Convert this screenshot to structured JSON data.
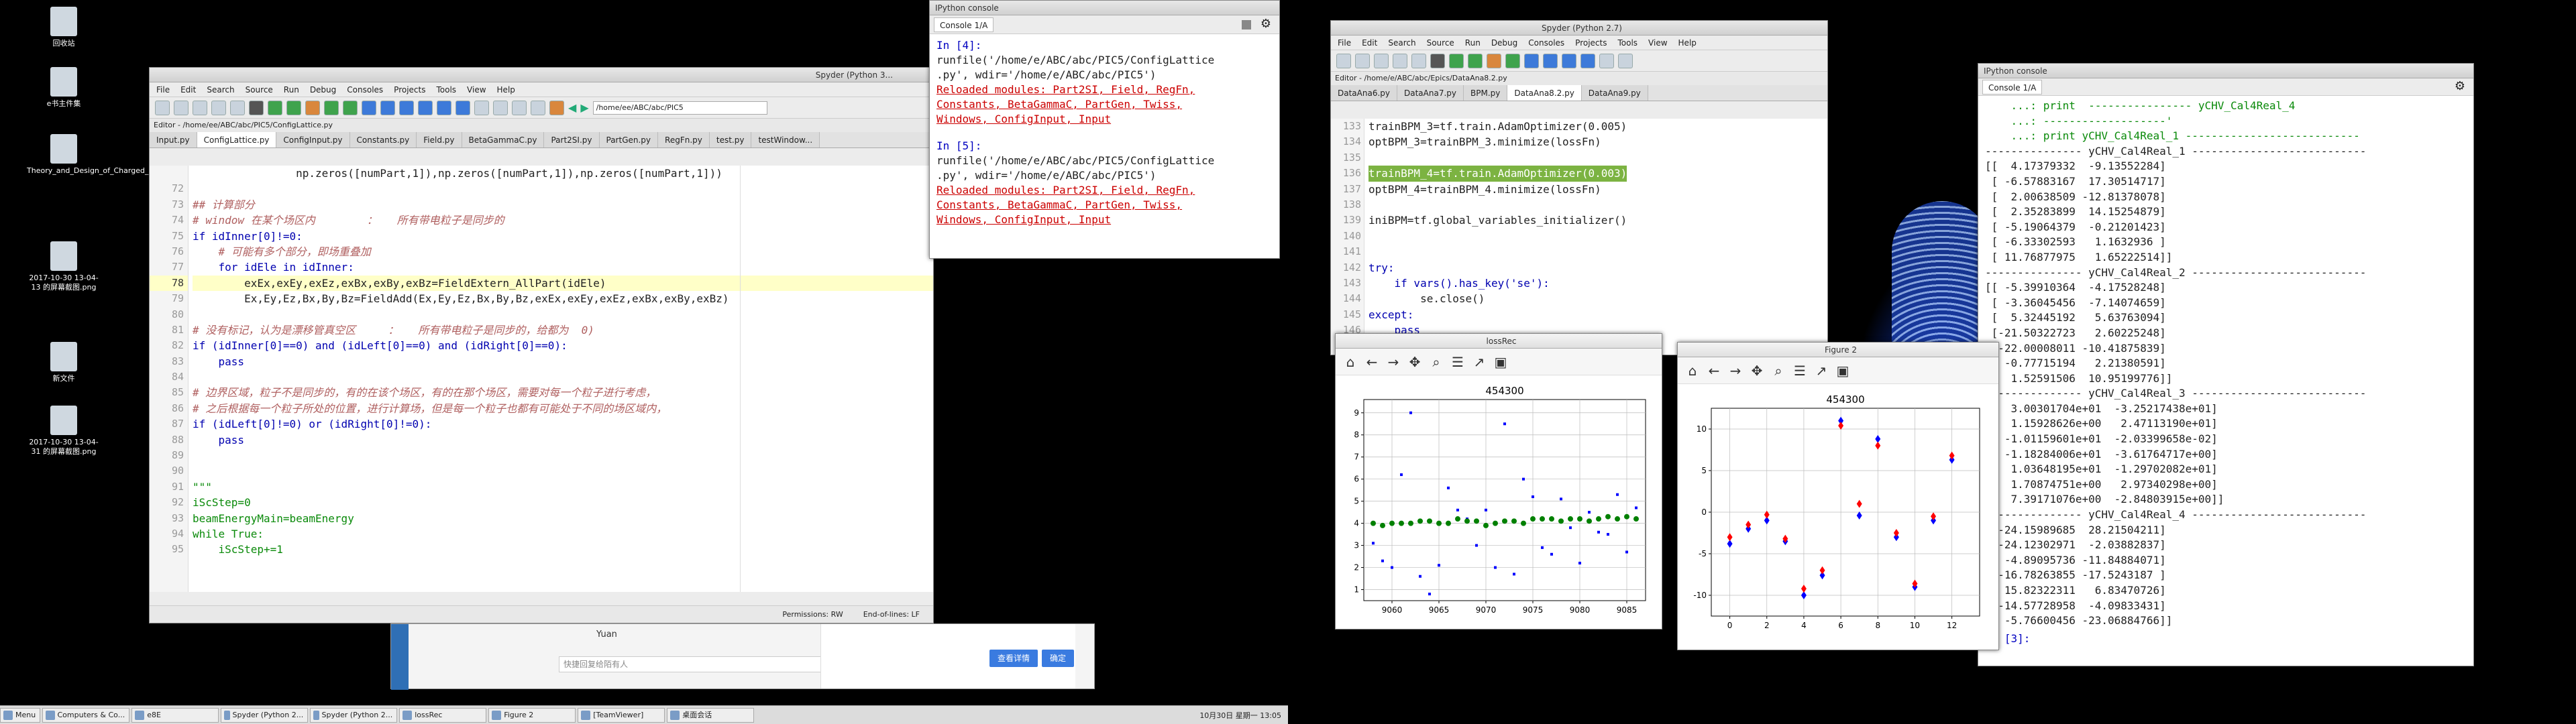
{
  "desktop": {
    "icons": [
      {
        "label": "回收站"
      },
      {
        "label": "e书主件集"
      },
      {
        "label": "Theory_and_Design_of_Charged_Particle_[Reiser_M.]_(BookFi..."
      },
      {
        "label": "2017-10-30 13-04-13 的屏幕截图.png"
      },
      {
        "label": "新文件"
      },
      {
        "label": "2017-10-30 13-04-31 的屏幕截图.png"
      }
    ]
  },
  "spyder_left": {
    "title": "Spyder (Python 3...",
    "menu": [
      "File",
      "Edit",
      "Search",
      "Source",
      "Run",
      "Debug",
      "Consoles",
      "Projects",
      "Tools",
      "View",
      "Help"
    ],
    "path": "/home/ee/ABC/abc/PIC5",
    "editor_title": "Editor - /home/ee/ABC/abc/PIC5/ConfigLattice.py",
    "tabs": [
      "Input.py",
      "ConfigLattice.py",
      "ConfigInput.py",
      "Constants.py",
      "Field.py",
      "BetaGammaC.py",
      "Part2SI.py",
      "PartGen.py",
      "RegFn.py",
      "test.py",
      "testWindow..."
    ],
    "active_tab": 1,
    "lines": [
      {
        "n": "",
        "t": "                np.zeros([numPart,1]),np.zeros([numPart,1]),np.zeros([numPart,1]))",
        "c": ""
      },
      {
        "n": "72",
        "t": "",
        "c": ""
      },
      {
        "n": "73",
        "t": "## 计算部分",
        "c": "cm"
      },
      {
        "n": "74",
        "t": "# window 在某个场区内        ：   所有带电粒子是同步的",
        "c": "cm"
      },
      {
        "n": "75",
        "t": "if idInner[0]!=0:",
        "c": "kw"
      },
      {
        "n": "76",
        "t": "    # 可能有多个部分，即场重叠加",
        "c": "cm"
      },
      {
        "n": "77",
        "t": "    for idEle in idInner:",
        "c": "kw"
      },
      {
        "n": "78",
        "t": "        exEx,exEy,exEz,exBx,exBy,exBz=FieldExtern_AllPart(idEle)",
        "c": ""
      },
      {
        "n": "79",
        "t": "        Ex,Ey,Ez,Bx,By,Bz=FieldAdd(Ex,Ey,Ez,Bx,By,Bz,exEx,exEy,exEz,exBx,exBy,exBz)",
        "c": ""
      },
      {
        "n": "80",
        "t": "",
        "c": ""
      },
      {
        "n": "81",
        "t": "# 没有标记，认为是漂移管真空区     ：   所有带电粒子是同步的，给都为  0)",
        "c": "cm"
      },
      {
        "n": "82",
        "t": "if (idInner[0]==0) and (idLeft[0]==0) and (idRight[0]==0):",
        "c": "kw"
      },
      {
        "n": "83",
        "t": "    pass",
        "c": "kw"
      },
      {
        "n": "84",
        "t": "",
        "c": ""
      },
      {
        "n": "85",
        "t": "# 边界区域，粒子不是同步的，有的在该个场区，有的在那个场区，需要对每一个粒子进行考虑，",
        "c": "cm"
      },
      {
        "n": "86",
        "t": "# 之后根据每一个粒子所处的位置，进行计算场，但是每一个粒子也都有可能处于不同的场区域内，",
        "c": "cm"
      },
      {
        "n": "87",
        "t": "if (idLeft[0]!=0) or (idRight[0]!=0):",
        "c": "kw"
      },
      {
        "n": "88",
        "t": "    pass",
        "c": "kw"
      },
      {
        "n": "89",
        "t": "",
        "c": ""
      },
      {
        "n": "90",
        "t": "",
        "c": ""
      },
      {
        "n": "91",
        "t": "\"\"\"",
        "c": "str"
      },
      {
        "n": "92",
        "t": "iScStep=0",
        "c": "str"
      },
      {
        "n": "93",
        "t": "beamEnergyMain=beamEnergy",
        "c": "str"
      },
      {
        "n": "94",
        "t": "while True:",
        "c": "str"
      },
      {
        "n": "95",
        "t": "    iScStep+=1",
        "c": "str"
      }
    ],
    "highlight_line": 7,
    "status": {
      "permissions": "Permissions: RW",
      "eol": "End-of-lines: LF"
    }
  },
  "ipython_left": {
    "title": "IPython console",
    "tab": "Console 1/A",
    "blocks": [
      {
        "prompt": "In [4]:",
        "cmd1": "runfile('/home/e/ABC/abc/PIC5/ConfigLattice",
        "cmd2": ".py', wdir='/home/e/ABC/abc/PIC5')",
        "reload": "Reloaded modules: Part2SI, Field, RegFn,",
        "mods1": "Constants, BetaGammaC, PartGen, Twiss,",
        "mods2": "Windows, ConfigInput, Input"
      },
      {
        "prompt": "In [5]:",
        "cmd1": "runfile('/home/e/ABC/abc/PIC5/ConfigLattice",
        "cmd2": ".py', wdir='/home/e/ABC/abc/PIC5')",
        "reload": "Reloaded modules: Part2SI, Field, RegFn,",
        "mods1": "Constants, BetaGammaC, PartGen, Twiss,",
        "mods2": "Windows, ConfigInput, Input"
      }
    ]
  },
  "chat_popup": {
    "name": "Yuan",
    "placeholder": "快捷回复给陌有人",
    "btn1": "查看详情",
    "btn2": "确定"
  },
  "taskbar": {
    "menu": "Menu",
    "items": [
      "Computers & Co...",
      "e8E",
      "Spyder (Python 2...",
      "Spyder (Python 2...",
      "lossRec",
      "Figure 2",
      "[TeamViewer]",
      "桌面会话"
    ],
    "clock": "10月30日 星期一 13:05"
  },
  "spyder_right": {
    "title": "Spyder (Python 2.7)",
    "menu": [
      "File",
      "Edit",
      "Search",
      "Source",
      "Run",
      "Debug",
      "Consoles",
      "Projects",
      "Tools",
      "View",
      "Help"
    ],
    "editor_title": "Editor - /home/e/ABC/abc/Epics/DataAna8.2.py",
    "tabs": [
      "DataAna6.py",
      "DataAna7.py",
      "BPM.py",
      "DataAna8.2.py",
      "DataAna9.py"
    ],
    "active_tab": 3,
    "lines": [
      {
        "n": "133",
        "t": "trainBPM_3=tf.train.AdamOptimizer(0.005)",
        "c": ""
      },
      {
        "n": "134",
        "t": "optBPM_3=trainBPM_3.minimize(lossFn)",
        "c": ""
      },
      {
        "n": "135",
        "t": "",
        "c": ""
      },
      {
        "n": "136",
        "t": "trainBPM_4=tf.train.AdamOptimizer(0.003)",
        "c": "sel"
      },
      {
        "n": "137",
        "t": "optBPM_4=trainBPM_4.minimize(lossFn)",
        "c": ""
      },
      {
        "n": "138",
        "t": "",
        "c": ""
      },
      {
        "n": "139",
        "t": "iniBPM=tf.global_variables_initializer()",
        "c": ""
      },
      {
        "n": "140",
        "t": "",
        "c": ""
      },
      {
        "n": "141",
        "t": "",
        "c": ""
      },
      {
        "n": "142",
        "t": "try:",
        "c": "kw"
      },
      {
        "n": "143",
        "t": "    if vars().has_key('se'):",
        "c": "kw"
      },
      {
        "n": "144",
        "t": "        se.close()",
        "c": ""
      },
      {
        "n": "145",
        "t": "except:",
        "c": "kw"
      },
      {
        "n": "146",
        "t": "    pass",
        "c": "kw"
      }
    ]
  },
  "fig_loss": {
    "title": "lossRec",
    "chart_data": {
      "type": "scatter",
      "title": "454300",
      "xlim": [
        9057,
        9087
      ],
      "ylim": [
        0.5,
        9.6
      ],
      "xticks": [
        9060,
        9065,
        9070,
        9075,
        9080,
        9085
      ],
      "yticks": [
        1,
        2,
        3,
        4,
        5,
        6,
        7,
        8,
        9
      ],
      "grid": true,
      "series": [
        {
          "color": "#0000ff",
          "x": [
            9058,
            9059,
            9060,
            9061,
            9062,
            9063,
            9064,
            9065,
            9066,
            9067,
            9068,
            9069,
            9070,
            9071,
            9072,
            9073,
            9074,
            9075,
            9076,
            9077,
            9078,
            9079,
            9080,
            9081,
            9082,
            9083,
            9084,
            9085,
            9086
          ],
          "y": [
            3.1,
            2.3,
            2.0,
            6.2,
            9.0,
            1.6,
            0.8,
            2.1,
            5.6,
            4.6,
            4.2,
            3.0,
            4.6,
            2.0,
            8.5,
            1.7,
            6.0,
            5.2,
            2.9,
            2.6,
            5.1,
            3.8,
            2.2,
            4.5,
            3.6,
            3.5,
            5.3,
            2.7,
            4.7
          ]
        },
        {
          "color": "#008000",
          "x": [
            9058,
            9059,
            9060,
            9061,
            9062,
            9063,
            9064,
            9065,
            9066,
            9067,
            9068,
            9069,
            9070,
            9071,
            9072,
            9073,
            9074,
            9075,
            9076,
            9077,
            9078,
            9079,
            9080,
            9081,
            9082,
            9083,
            9084,
            9085,
            9086
          ],
          "y": [
            4.0,
            3.9,
            4.0,
            4.0,
            4.0,
            4.1,
            4.1,
            4.0,
            4.0,
            4.2,
            4.1,
            4.1,
            3.9,
            4.0,
            4.1,
            4.1,
            4.0,
            4.2,
            4.2,
            4.2,
            4.1,
            4.2,
            4.2,
            4.1,
            4.2,
            4.3,
            4.2,
            4.3,
            4.2
          ]
        }
      ]
    }
  },
  "fig2": {
    "title": "Figure 2",
    "chart_data": {
      "type": "scatter",
      "title": "454300",
      "xlim": [
        -1,
        13.5
      ],
      "ylim": [
        -12.5,
        12.5
      ],
      "xticks": [
        0,
        2,
        4,
        6,
        8,
        10,
        12
      ],
      "yticks": [
        -10,
        -5,
        0,
        5,
        10
      ],
      "grid": true,
      "series": [
        {
          "color": "#0000ff",
          "x": [
            0,
            1,
            2,
            3,
            4,
            5,
            6,
            7,
            8,
            9,
            10,
            11,
            12
          ],
          "y": [
            -3.8,
            -2.0,
            -1.0,
            -3.5,
            -10.0,
            -7.6,
            11.0,
            -0.4,
            8.8,
            -3.0,
            -9.0,
            -1.0,
            6.3
          ]
        },
        {
          "color": "#ff0000",
          "x": [
            0,
            1,
            2,
            3,
            4,
            5,
            6,
            7,
            8,
            9,
            10,
            11,
            12
          ],
          "y": [
            -3.0,
            -1.5,
            -0.3,
            -3.2,
            -9.2,
            -7.0,
            10.4,
            1.0,
            8.0,
            -2.5,
            -8.6,
            -0.5,
            6.8
          ]
        }
      ]
    }
  },
  "ipython_right": {
    "title": "IPython console",
    "tab": "Console 1/A",
    "lines": [
      "    ...: print  ---------------- yCHV_Cal4Real_4",
      "    ...: -------------------'",
      "    ...: print yCHV_Cal4Real_1 ---------------------------",
      "--------------- yCHV_Cal4Real_1 ---------------------------",
      "[[  4.17379332  -9.13552284]",
      " [ -6.57883167  17.30514717]",
      " [  2.00638509 -12.81378078]",
      " [  2.35283899  14.15254879]",
      " [ -5.19064379  -0.21201423]",
      " [ -6.33302593   1.1632936 ]",
      " [ 11.76877975   1.65222514]]",
      "--------------- yCHV_Cal4Real_2 ---------------------------",
      "[[ -5.39910364  -4.17528248]",
      " [ -3.36045456  -7.14074659]",
      " [  5.32445192   5.63763094]",
      " [-21.50322723   2.60225248]",
      " [-22.00008011 -10.41875839]",
      " [ -0.77715194   2.21380591]",
      " [  1.52591506  10.95199776]]",
      "--------------- yCHV_Cal4Real_3 ---------------------------",
      "[[  3.00301704e+01  -3.25217438e+01]",
      " [  1.15928626e+00   2.47113190e+01]",
      " [ -1.01159601e+01  -2.03399658e-02]",
      " [ -1.18284006e+01  -3.61764717e+00]",
      " [  1.03648195e+01  -1.29702082e+01]",
      " [  1.70874751e+00   2.97340298e+00]",
      " [  7.39171076e+00  -2.84803915e+00]]",
      "--------------- yCHV_Cal4Real_4 ---------------------------",
      "[[-24.15989685  28.21504211]",
      " [-24.12302971  -2.03882837]",
      " [ -4.89095736 -11.84884071]",
      " [-16.78263855 -17.5243187 ]",
      " [ 15.82322311   6.83470726]",
      " [-14.57728958  -4.09833431]",
      " [ -5.76600456 -23.06884766]]"
    ],
    "prompt": "In [3]:"
  }
}
